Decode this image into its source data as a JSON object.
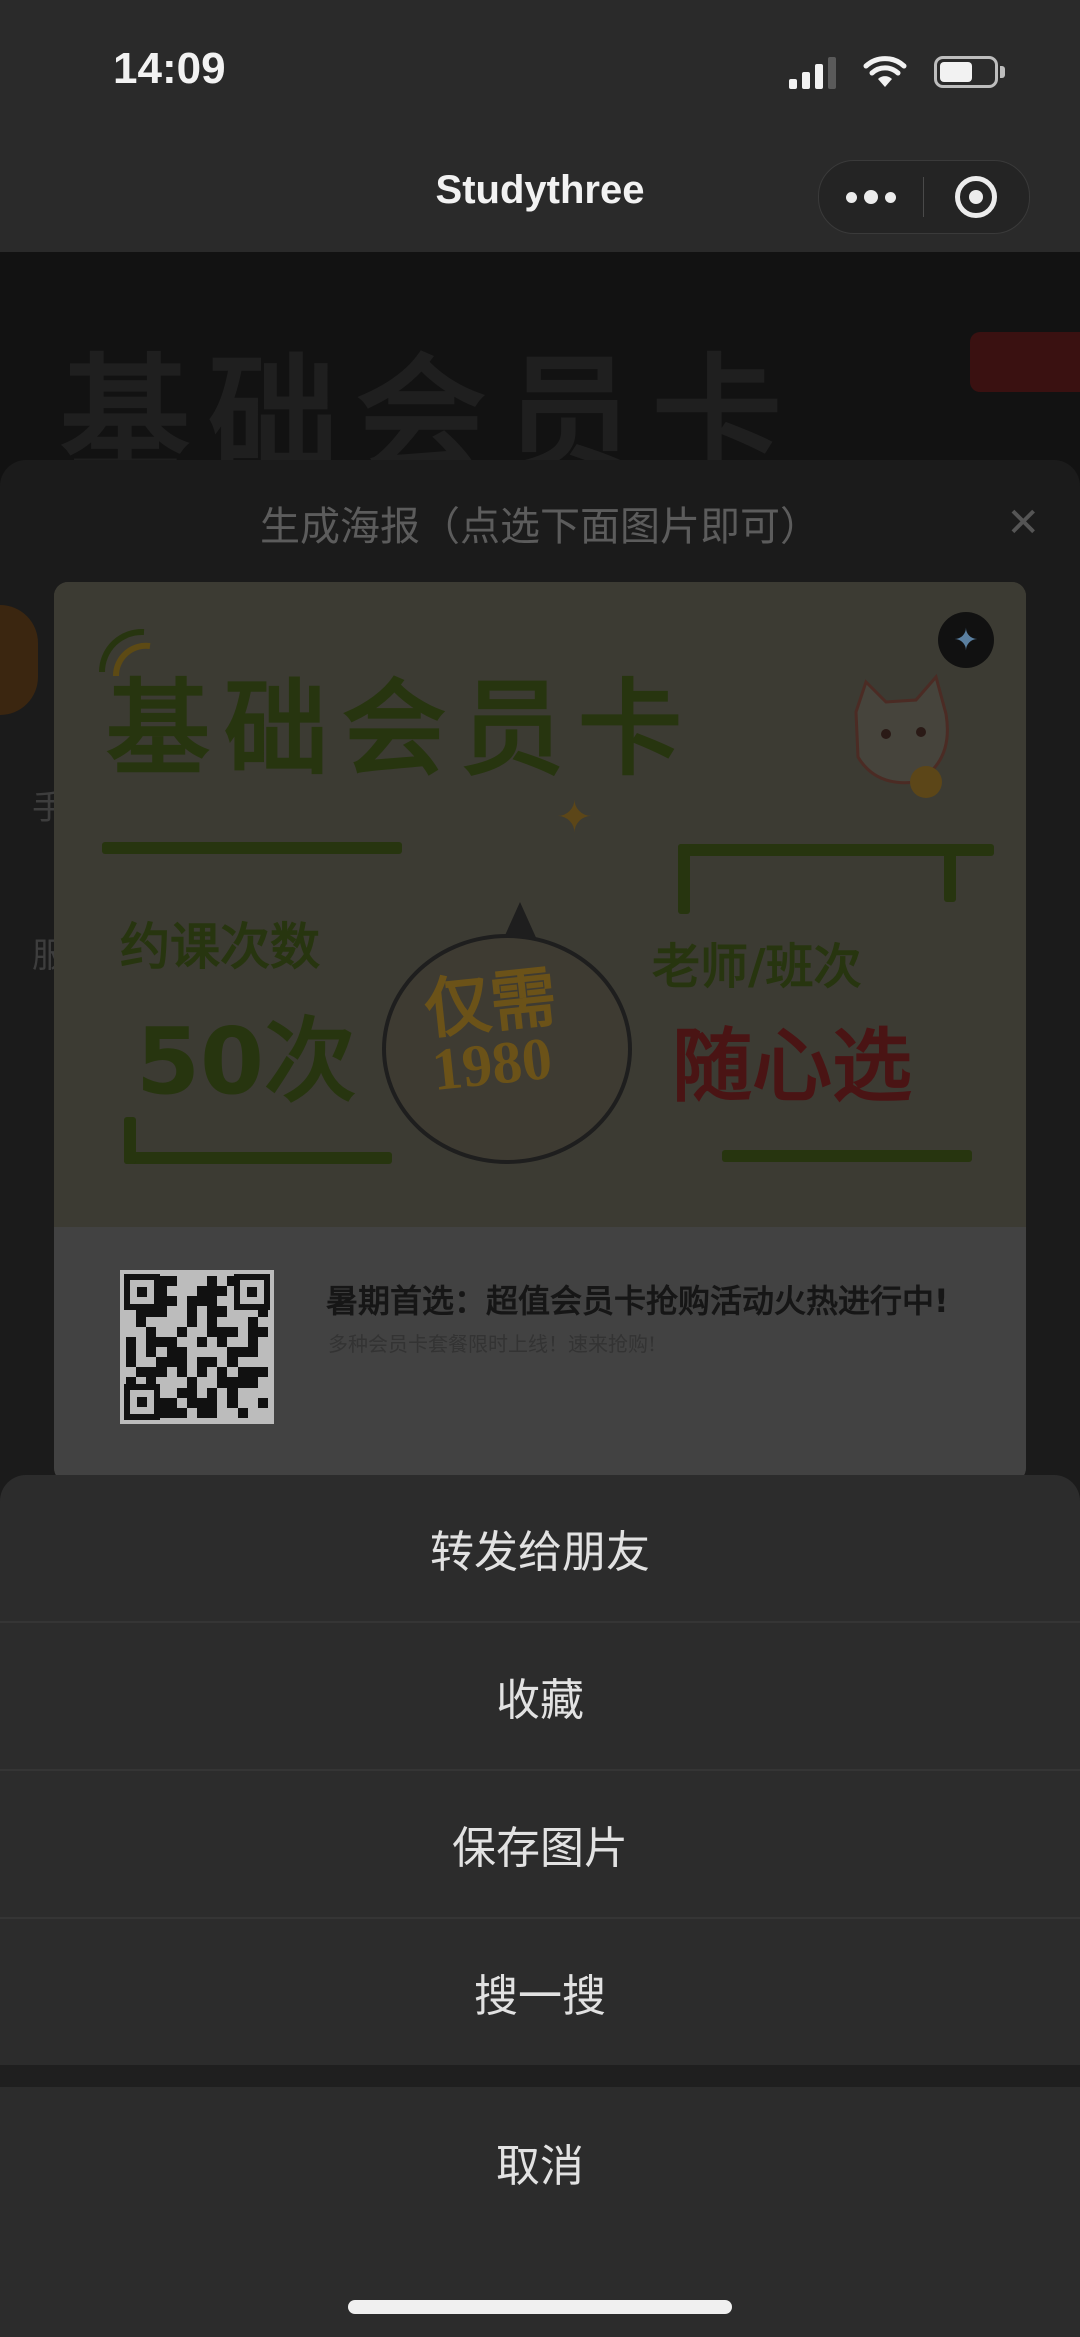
{
  "status_bar": {
    "time": "14:09",
    "battery_level": 0.62
  },
  "nav": {
    "title": "Studythree"
  },
  "background": {
    "banner_title": "基础会员卡"
  },
  "poster_sheet": {
    "title": "生成海报（点选下面图片即可）",
    "close_symbol": "✕",
    "side_text_1": "手",
    "side_text_2": "服"
  },
  "poster": {
    "title": "基础会员卡",
    "count_label": "约课次数",
    "count_value": "50次",
    "bubble_only": "仅需",
    "bubble_price": "1980",
    "teacher_label": "老师/班次",
    "free_choice": "随心选",
    "headline": "暑期首选：超值会员卡抢购活动火热进行中!",
    "subline": "多种会员卡套餐限时上线！速来抢购!"
  },
  "action_sheet": {
    "items": [
      {
        "label": "转发给朋友"
      },
      {
        "label": "收藏"
      },
      {
        "label": "保存图片"
      },
      {
        "label": "搜一搜"
      }
    ],
    "cancel": "取消"
  }
}
